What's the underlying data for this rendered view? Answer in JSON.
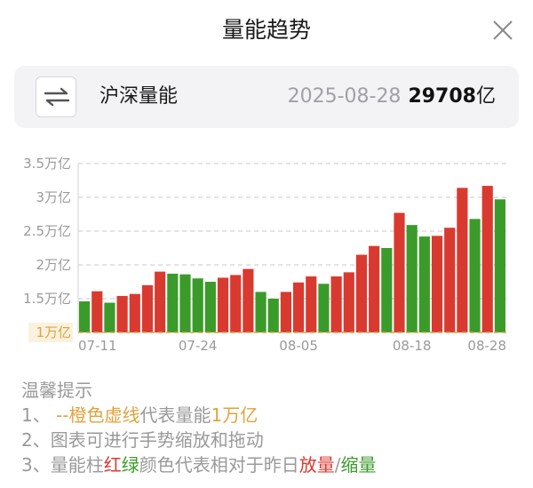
{
  "header": {
    "title": "量能趋势",
    "close_icon": "close-icon"
  },
  "card": {
    "swap_icon": "swap-arrows-icon",
    "name": "沪深量能",
    "date": "2025-08-28",
    "value": "29708",
    "unit": "亿"
  },
  "colors": {
    "up": "#d93a30",
    "down": "#3b9b2a",
    "reference": "#e0a33c",
    "grid": "#c8c8c8"
  },
  "chart_data": {
    "type": "bar",
    "y_tick_labels": [
      "3.5万亿",
      "3万亿",
      "2.5万亿",
      "2万亿",
      "1.5万亿",
      "1万亿"
    ],
    "y_ticks": [
      3.5,
      3,
      2.5,
      2,
      1.5,
      1
    ],
    "ylim": [
      1,
      3.5
    ],
    "x_tick_labels": [
      "07-11",
      "07-24",
      "08-05",
      "08-18",
      "08-28"
    ],
    "x_tick_index": [
      0,
      9,
      17,
      26,
      34
    ],
    "reference_line": 1,
    "grid": true,
    "series": [
      {
        "values": [
          1.46,
          1.61,
          1.44,
          1.54,
          1.57,
          1.7,
          1.9,
          1.87,
          1.86,
          1.8,
          1.75,
          1.81,
          1.85,
          1.94,
          1.6,
          1.5,
          1.6,
          1.74,
          1.83,
          1.72,
          1.83,
          1.89,
          2.15,
          2.28,
          2.25,
          2.77,
          2.59,
          2.42,
          2.43,
          2.55,
          3.14,
          2.68,
          3.17,
          2.97
        ],
        "colors": [
          "down",
          "up",
          "down",
          "up",
          "up",
          "up",
          "up",
          "down",
          "down",
          "down",
          "down",
          "up",
          "up",
          "up",
          "down",
          "down",
          "up",
          "up",
          "up",
          "down",
          "up",
          "up",
          "up",
          "up",
          "down",
          "up",
          "down",
          "down",
          "up",
          "up",
          "up",
          "down",
          "up",
          "down"
        ]
      }
    ]
  },
  "notes": {
    "heading": "温馨提示",
    "line1_prefix": "1、 ",
    "line1_orange": "--橙色虚线",
    "line1_mid": "代表量能",
    "line1_value": "1万亿",
    "line2": "2、图表可进行手势缩放和拖动",
    "line3_prefix": "3、量能柱",
    "line3_red": "红",
    "line3_green": "绿",
    "line3_mid": "颜色代表相对于昨日",
    "line3_up": "放量",
    "line3_sep": "/",
    "line3_down": "缩量"
  }
}
